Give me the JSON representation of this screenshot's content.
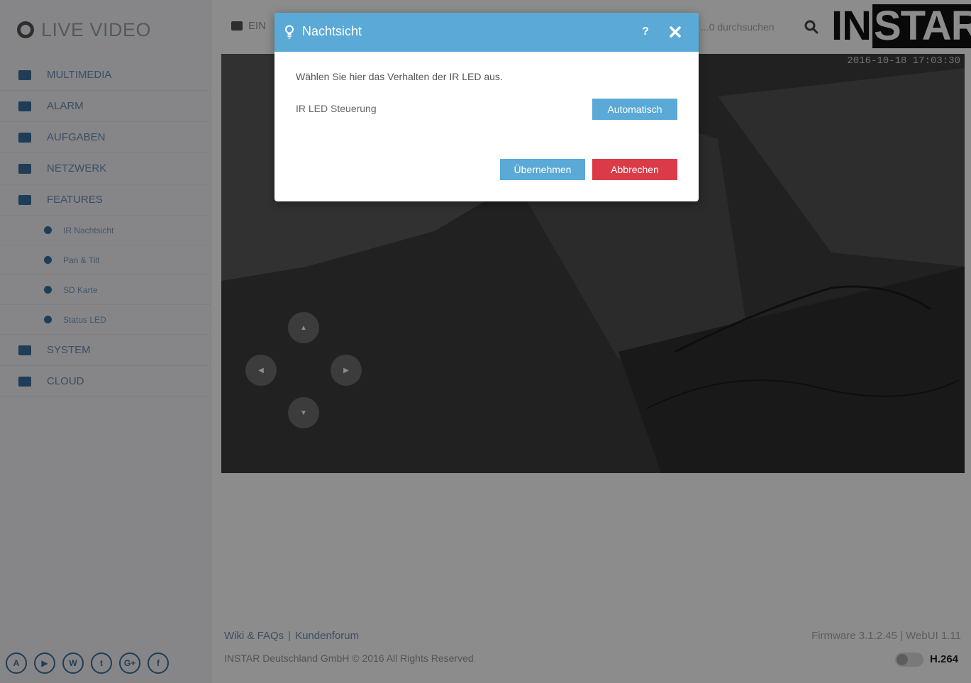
{
  "sidebar": {
    "brand": "LIVE VIDEO",
    "items": [
      {
        "label": "MULTIMEDIA",
        "icon": "image-icon"
      },
      {
        "label": "ALARM",
        "icon": "bell-icon"
      },
      {
        "label": "AUFGABEN",
        "icon": "film-icon"
      },
      {
        "label": "NETZWERK",
        "icon": "network-icon"
      },
      {
        "label": "FEATURES",
        "icon": "gear-icon"
      }
    ],
    "sub_items": [
      {
        "label": "IR Nachtsicht",
        "icon": "bulb-icon"
      },
      {
        "label": "Pan & Tilt",
        "icon": "move-icon"
      },
      {
        "label": "SD Karte",
        "icon": "sdcard-icon"
      },
      {
        "label": "Status LED",
        "icon": "led-icon"
      }
    ],
    "bottom_items": [
      {
        "label": "SYSTEM",
        "icon": "cog-icon"
      },
      {
        "label": "CLOUD",
        "icon": "cloud-icon"
      }
    ],
    "social": [
      "A",
      "▶",
      "W",
      "t",
      "G+",
      "f"
    ]
  },
  "topbar": {
    "menu_label": "EIN",
    "search_text": "...0 durchsuchen",
    "logo_left": "IN",
    "logo_right": "STAR"
  },
  "video": {
    "timestamp": "2016-10-18 17:03:30"
  },
  "footer": {
    "link_wiki": "Wiki & FAQs",
    "separator": "|",
    "link_forum": "Kundenforum",
    "copyright": "INSTAR Deutschland GmbH © 2016 All Rights Reserved",
    "firmware": "Firmware 3.1.2.45 | WebUI 1.11",
    "codec": "H.264"
  },
  "modal": {
    "title": "Nachtsicht",
    "help_label": "?",
    "description": "Wählen Sie hier das Verhalten der IR LED aus.",
    "ir_label": "IR LED Steuerung",
    "ir_mode": "Automatisch",
    "apply_label": "Übernehmen",
    "cancel_label": "Abbrechen",
    "colors": {
      "header": "#5aa9d6",
      "primary": "#5aa9d6",
      "danger": "#db3b47"
    }
  }
}
